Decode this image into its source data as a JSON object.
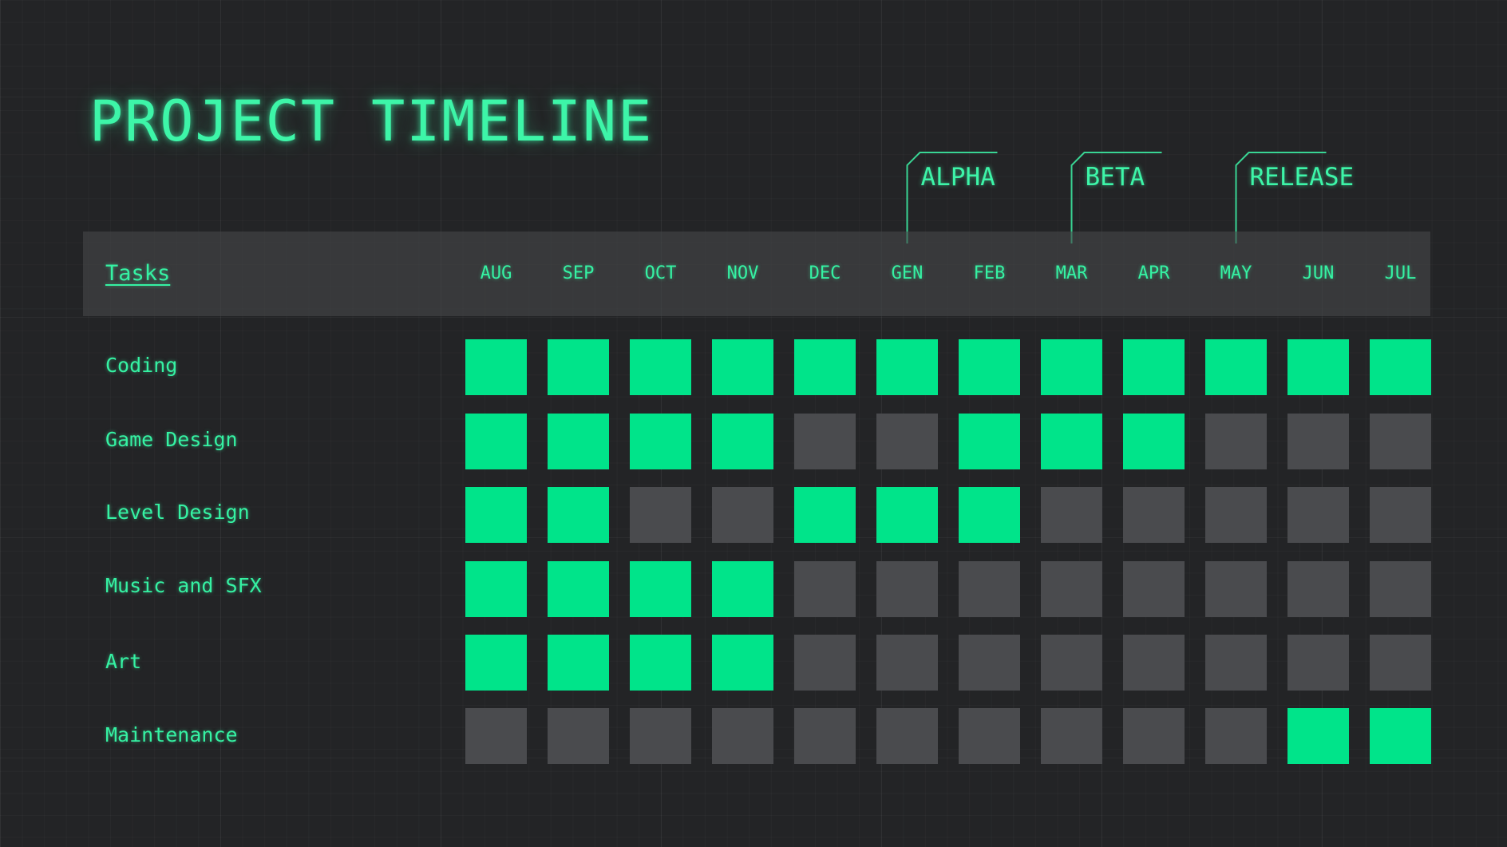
{
  "title": "PROJECT TIMELINE",
  "colors": {
    "accent": "#3df5a8",
    "active_cell": "#00e48a",
    "inactive_cell": "#4a4b4e",
    "background": "#232426"
  },
  "header": {
    "tasks_label": "Tasks"
  },
  "months": [
    "AUG",
    "SEP",
    "OCT",
    "NOV",
    "DEC",
    "GEN",
    "FEB",
    "MAR",
    "APR",
    "MAY",
    "JUN",
    "JUL"
  ],
  "milestones": [
    {
      "label": "ALPHA",
      "month": "GEN"
    },
    {
      "label": "BETA",
      "month": "MAR"
    },
    {
      "label": "RELEASE",
      "month": "MAY"
    }
  ],
  "tasks": [
    {
      "name": "Coding",
      "active": [
        1,
        1,
        1,
        1,
        1,
        1,
        1,
        1,
        1,
        1,
        1,
        1
      ]
    },
    {
      "name": "Game Design",
      "active": [
        1,
        1,
        1,
        1,
        0,
        0,
        1,
        1,
        1,
        0,
        0,
        0
      ]
    },
    {
      "name": "Level Design",
      "active": [
        1,
        1,
        0,
        0,
        1,
        1,
        1,
        0,
        0,
        0,
        0,
        0
      ]
    },
    {
      "name": "Music and SFX",
      "active": [
        1,
        1,
        1,
        1,
        0,
        0,
        0,
        0,
        0,
        0,
        0,
        0
      ]
    },
    {
      "name": "Art",
      "active": [
        1,
        1,
        1,
        1,
        0,
        0,
        0,
        0,
        0,
        0,
        0,
        0
      ]
    },
    {
      "name": "Maintenance",
      "active": [
        0,
        0,
        0,
        0,
        0,
        0,
        0,
        0,
        0,
        0,
        1,
        1
      ]
    }
  ]
}
